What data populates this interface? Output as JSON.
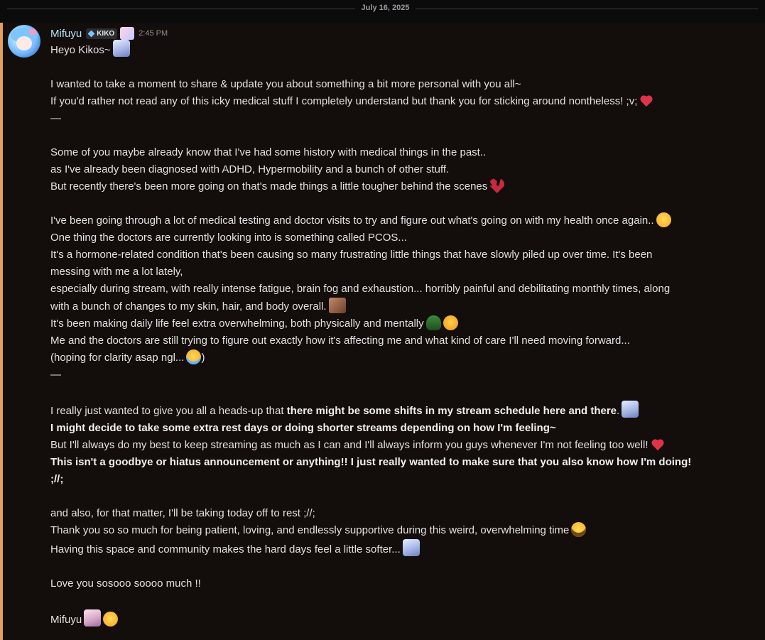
{
  "date_divider": "July 16, 2025",
  "message": {
    "author": "Mifuyu",
    "role_tag": "KIKO",
    "timestamp": "2:45 PM",
    "accent_color": "#e2a05a",
    "author_color": "#b5e3f7",
    "lines": {
      "l01": "Heyo Kikos~",
      "l03": "I wanted to take a moment to share & update you about something a bit more personal with you all~",
      "l04": "If you'd rather not read any of this icky medical stuff I completely understand but thank you for sticking around nontheless! ;v;",
      "l05": "—",
      "l07": "Some of you maybe already know that I've had some history with medical things in the past..",
      "l08": "as I've already been diagnosed with ADHD, Hypermobility and a bunch of other stuff.",
      "l09": "But recently there's been more going on that's made things a little tougher behind the scenes",
      "l11": "I've been going through a lot of medical testing and doctor visits to try and figure out what's going on with my health once again..",
      "l12": "One thing the doctors are currently looking into is something called PCOS...",
      "l13": "It's a hormone-related condition that's been causing so many frustrating little things that have slowly piled up over time. It's been",
      "l14": "messing with me a lot lately,",
      "l15": "especially during stream, with really intense fatigue, brain fog and exhaustion... horribly painful and debilitating monthly times, along",
      "l16": "with a bunch of changes to my skin, hair, and body overall.",
      "l17": "It's been making daily life feel extra overwhelming, both physically and mentally",
      "l18": "Me and the doctors are still trying to figure out exactly how it's affecting me and what kind of care I'll need moving forward...",
      "l19a": "(hoping for clarity asap ngl...",
      "l19b": ")",
      "l20": "—",
      "l22a": "I really just wanted to give you all a heads-up that ",
      "l22b": "there might be some shifts in my stream schedule here and there",
      "l22c": ".",
      "l23": "I might decide to take some extra rest days or doing shorter streams depending on how I'm feeling~",
      "l24": "But I'll always do my best to keep streaming as much as I can and I'll always inform you guys whenever I'm not feeling too well!",
      "l25": "This isn't a goodbye or hiatus announcement or anything!! I just really wanted to make sure that you also know how I'm doing!",
      "l26": ";//;",
      "l28": "and also, for that matter, I'll be taking today off to rest ;//;",
      "l29": "Thank you so so much for being patient, loving, and endlessly supportive during this weird, overwhelming time",
      "l30": "Having this space and community makes the hard days feel a little softer...",
      "l32": "Love you sosooo soooo much !!",
      "l34": "Mifuyu"
    },
    "emojis": {
      "role": "custom-avatar-emoji",
      "heyo": "custom-sticker-emoji",
      "heart": "red-heart-emoji",
      "broken_heart": "broken-heart-emoji",
      "tear": "holding-back-tears-emoji",
      "skin": "custom-skin-emoji",
      "turtle": "turtle-emoji",
      "weary": "dizzy-face-emoji",
      "sob": "loudly-crying-emoji",
      "sticker_blue": "custom-sticker-emoji",
      "nerd": "nerd-face-emoji",
      "pleading": "pleading-face-emoji"
    }
  }
}
